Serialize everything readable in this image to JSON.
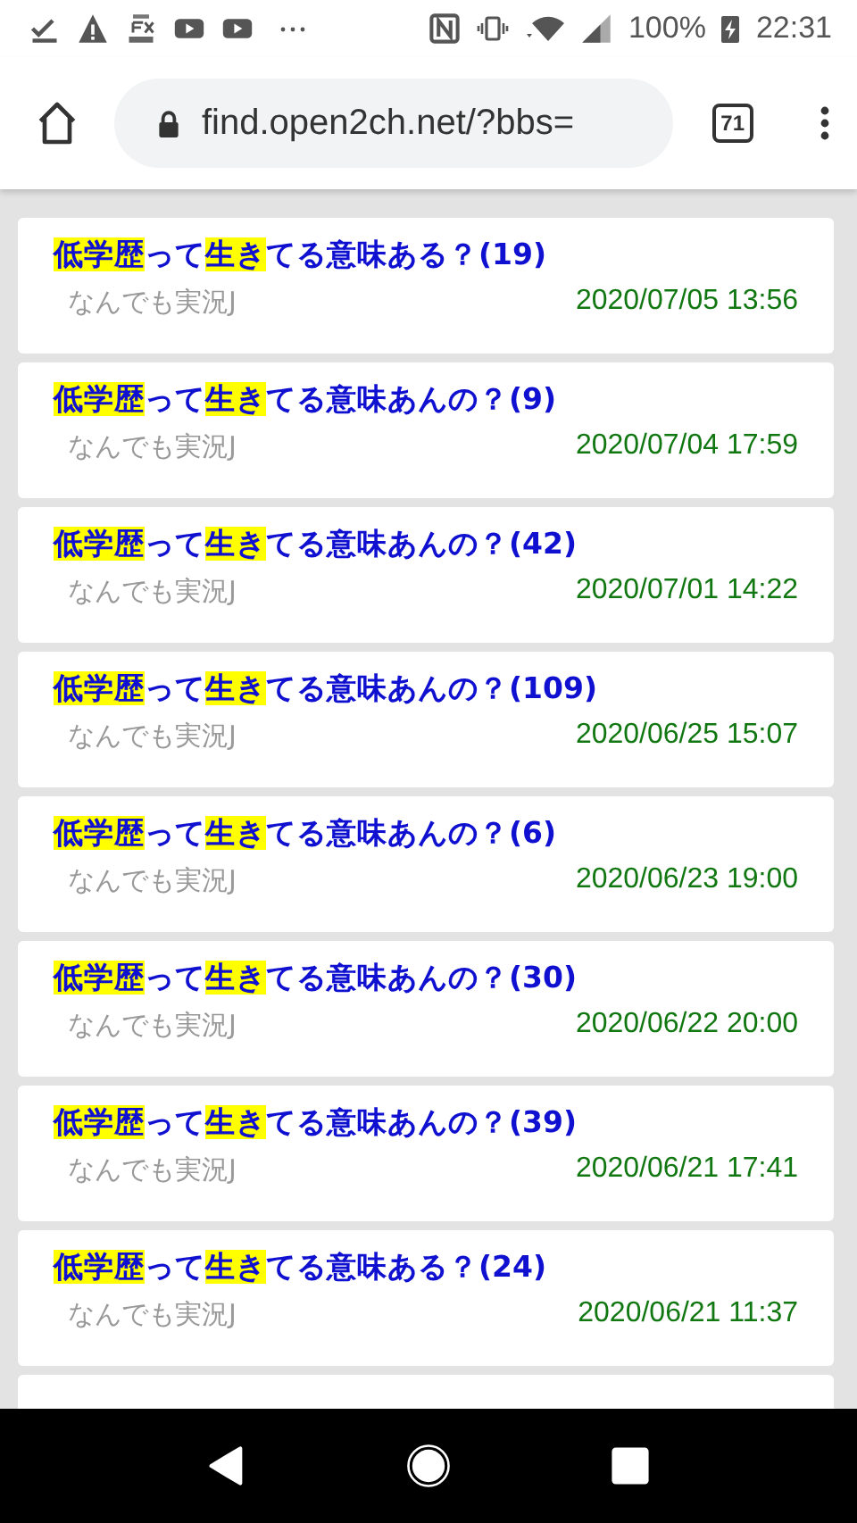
{
  "status_bar": {
    "battery": "100%",
    "time": "22:31"
  },
  "toolbar": {
    "url": "find.open2ch.net/?bbs=",
    "tab_count": "71"
  },
  "results": [
    {
      "title_parts": [
        {
          "text": "低学歴",
          "highlighted": true
        },
        {
          "text": "って",
          "highlighted": false
        },
        {
          "text": "生き",
          "highlighted": true
        },
        {
          "text": "てる意味ある？(19)",
          "highlighted": false
        }
      ],
      "board": "なんでも実況J",
      "date": "2020/07/05 13:56"
    },
    {
      "title_parts": [
        {
          "text": "低学歴",
          "highlighted": true
        },
        {
          "text": "って",
          "highlighted": false
        },
        {
          "text": "生き",
          "highlighted": true
        },
        {
          "text": "てる意味あんの？(9)",
          "highlighted": false
        }
      ],
      "board": "なんでも実況J",
      "date": "2020/07/04 17:59"
    },
    {
      "title_parts": [
        {
          "text": "低学歴",
          "highlighted": true
        },
        {
          "text": "って",
          "highlighted": false
        },
        {
          "text": "生き",
          "highlighted": true
        },
        {
          "text": "てる意味あんの？(42)",
          "highlighted": false
        }
      ],
      "board": "なんでも実況J",
      "date": "2020/07/01 14:22"
    },
    {
      "title_parts": [
        {
          "text": "低学歴",
          "highlighted": true
        },
        {
          "text": "って",
          "highlighted": false
        },
        {
          "text": "生き",
          "highlighted": true
        },
        {
          "text": "てる意味あんの？(109)",
          "highlighted": false
        }
      ],
      "board": "なんでも実況J",
      "date": "2020/06/25 15:07"
    },
    {
      "title_parts": [
        {
          "text": "低学歴",
          "highlighted": true
        },
        {
          "text": "って",
          "highlighted": false
        },
        {
          "text": "生き",
          "highlighted": true
        },
        {
          "text": "てる意味あんの？(6)",
          "highlighted": false
        }
      ],
      "board": "なんでも実況J",
      "date": "2020/06/23 19:00"
    },
    {
      "title_parts": [
        {
          "text": "低学歴",
          "highlighted": true
        },
        {
          "text": "って",
          "highlighted": false
        },
        {
          "text": "生き",
          "highlighted": true
        },
        {
          "text": "てる意味あんの？(30)",
          "highlighted": false
        }
      ],
      "board": "なんでも実況J",
      "date": "2020/06/22 20:00"
    },
    {
      "title_parts": [
        {
          "text": "低学歴",
          "highlighted": true
        },
        {
          "text": "って",
          "highlighted": false
        },
        {
          "text": "生き",
          "highlighted": true
        },
        {
          "text": "てる意味あんの？(39)",
          "highlighted": false
        }
      ],
      "board": "なんでも実況J",
      "date": "2020/06/21 17:41"
    },
    {
      "title_parts": [
        {
          "text": "低学歴",
          "highlighted": true
        },
        {
          "text": "って",
          "highlighted": false
        },
        {
          "text": "生き",
          "highlighted": true
        },
        {
          "text": "てる意味ある？(24)",
          "highlighted": false
        }
      ],
      "board": "なんでも実況J",
      "date": "2020/06/21 11:37"
    },
    {
      "kind": "partial"
    }
  ]
}
